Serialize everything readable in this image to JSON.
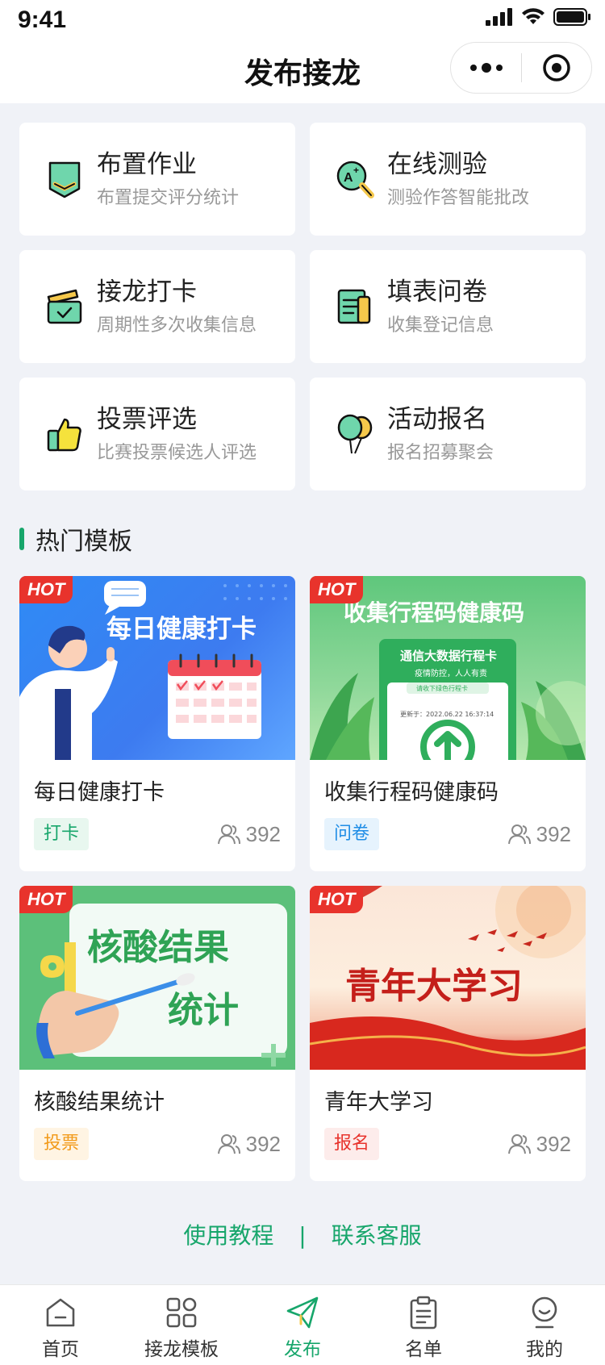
{
  "status_bar": {
    "time": "9:41"
  },
  "nav": {
    "title": "发布接龙"
  },
  "features": [
    {
      "title": "布置作业",
      "subtitle": "布置提交评分统计",
      "icon": "homework-icon"
    },
    {
      "title": "在线测验",
      "subtitle": "测验作答智能批改",
      "icon": "quiz-icon"
    },
    {
      "title": "接龙打卡",
      "subtitle": "周期性多次收集信息",
      "icon": "checkin-icon"
    },
    {
      "title": "填表问卷",
      "subtitle": "收集登记信息",
      "icon": "form-icon"
    },
    {
      "title": "投票评选",
      "subtitle": "比赛投票候选人评选",
      "icon": "thumbs-up-icon"
    },
    {
      "title": "活动报名",
      "subtitle": "报名招募聚会",
      "icon": "balloons-icon"
    }
  ],
  "section": {
    "title": "热门模板"
  },
  "templates": [
    {
      "name": "每日健康打卡",
      "tag": "打卡",
      "count": "392",
      "hot": "HOT",
      "thumb_title": "每日健康打卡",
      "tag_color": "#17a66b",
      "tag_bg": "#e8f7ef"
    },
    {
      "name": "收集行程码健康码",
      "tag": "问卷",
      "count": "392",
      "hot": "HOT",
      "thumb_title": "收集行程码健康码",
      "thumb_card_title": "通信大数据行程卡",
      "thumb_card_sub": "疫情防控，人人有责",
      "thumb_card_btn": "请收下绿色行程卡",
      "thumb_card_time": "更新于：2022.06.22 16:37:14",
      "tag_color": "#1f8de6",
      "tag_bg": "#e6f3fd"
    },
    {
      "name": "核酸结果统计",
      "tag": "投票",
      "count": "392",
      "hot": "HOT",
      "thumb_title_1": "核酸结果",
      "thumb_title_2": "统计",
      "tag_color": "#f29a1a",
      "tag_bg": "#fff4e3"
    },
    {
      "name": "青年大学习",
      "tag": "报名",
      "count": "392",
      "hot": "HOT",
      "thumb_title": "青年大学习",
      "tag_color": "#e8332c",
      "tag_bg": "#fdeceb"
    }
  ],
  "footer": {
    "tutorial": "使用教程",
    "separator": "|",
    "support": "联系客服"
  },
  "tabs": [
    {
      "label": "首页",
      "icon": "home-icon"
    },
    {
      "label": "接龙模板",
      "icon": "grid-icon"
    },
    {
      "label": "发布",
      "icon": "send-icon",
      "active": true
    },
    {
      "label": "名单",
      "icon": "clipboard-icon"
    },
    {
      "label": "我的",
      "icon": "profile-icon"
    }
  ],
  "colors": {
    "accent": "#17a66b",
    "hot": "#e8332c",
    "background": "#f0f2f7"
  }
}
